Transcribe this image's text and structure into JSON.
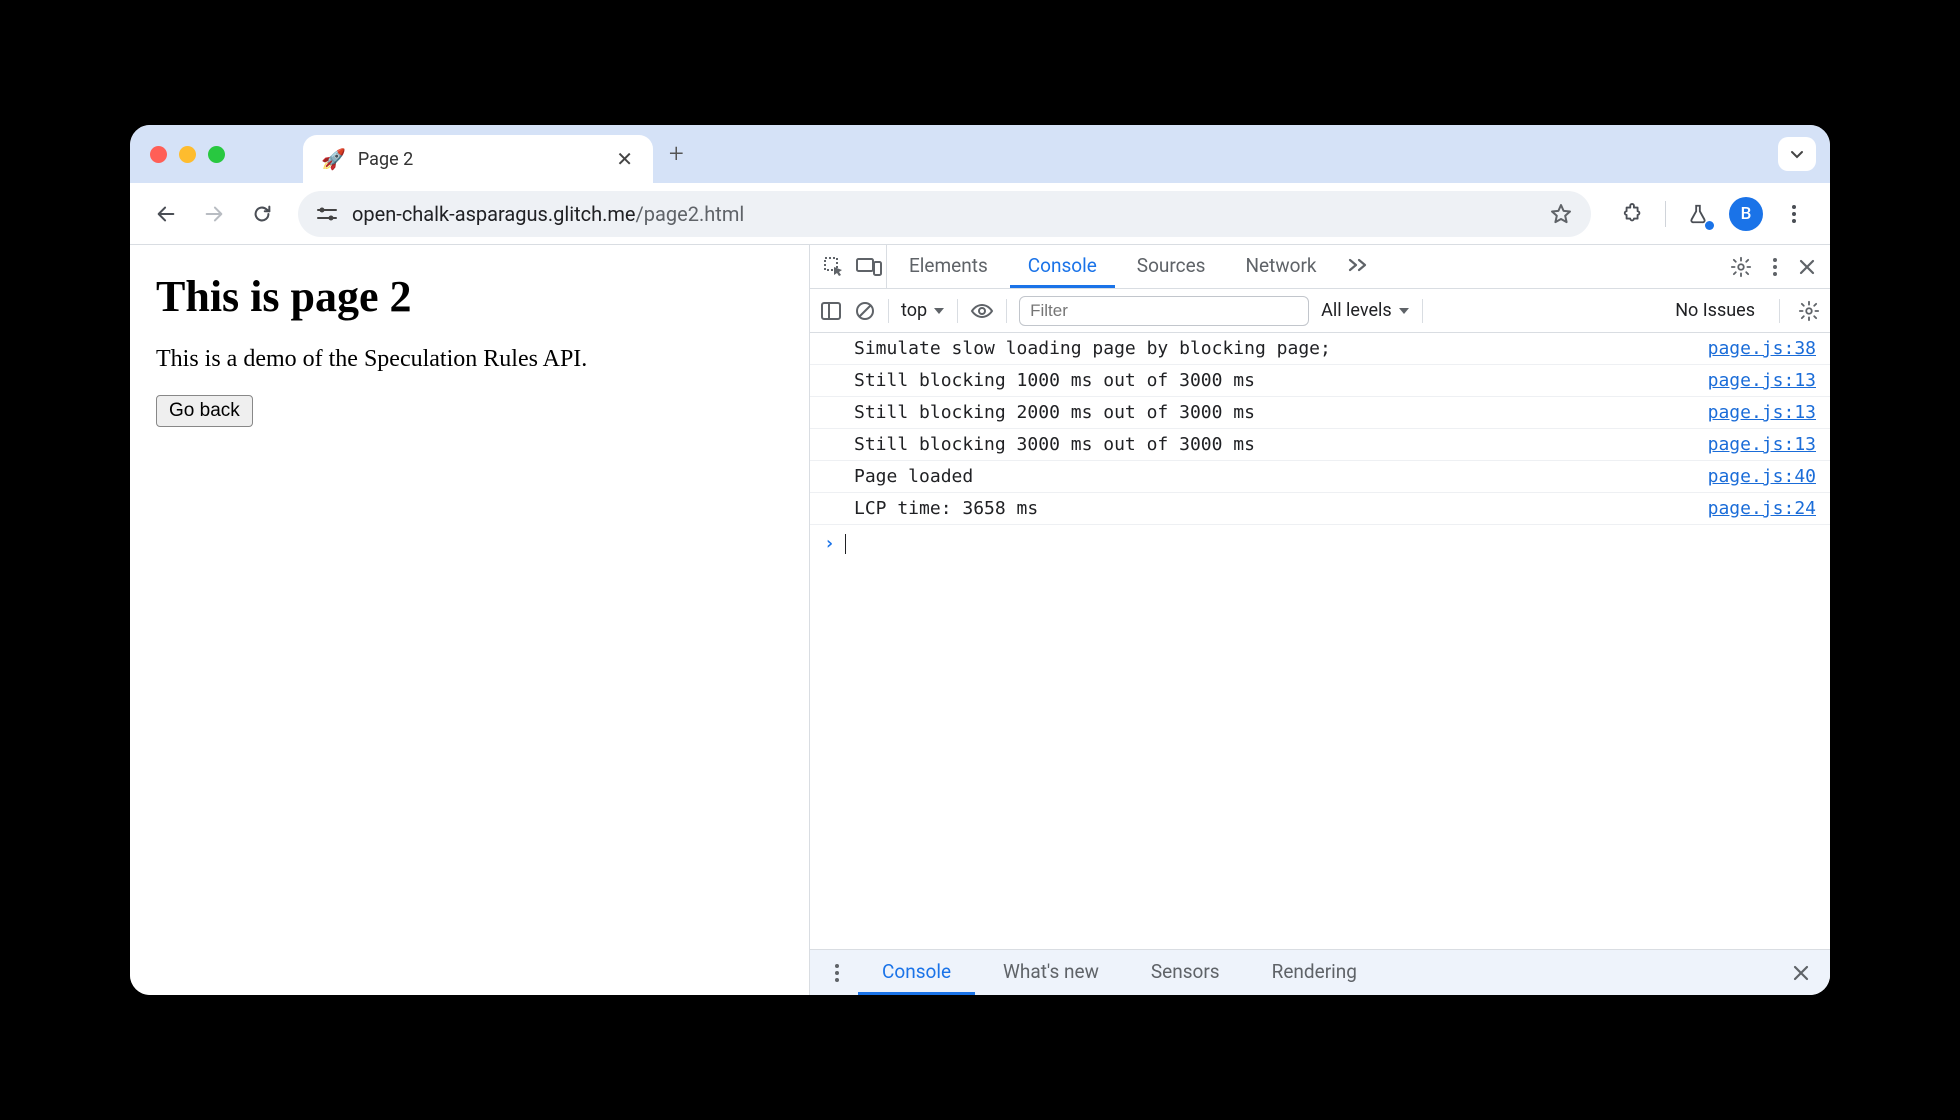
{
  "browser": {
    "tab": {
      "favicon": "🚀",
      "title": "Page 2"
    },
    "url_domain": "open-chalk-asparagus.glitch.me",
    "url_path": "/page2.html",
    "avatar_initial": "B"
  },
  "page": {
    "heading": "This is page 2",
    "description": "This is a demo of the Speculation Rules API.",
    "back_button": "Go back"
  },
  "devtools": {
    "tabs": {
      "elements": "Elements",
      "console": "Console",
      "sources": "Sources",
      "network": "Network"
    },
    "filterbar": {
      "context": "top",
      "filter_placeholder": "Filter",
      "levels": "All levels",
      "no_issues": "No Issues"
    },
    "log": [
      {
        "msg": "Simulate slow loading page by blocking page;",
        "src": "page.js:38"
      },
      {
        "msg": "Still blocking 1000 ms out of 3000 ms",
        "src": "page.js:13"
      },
      {
        "msg": "Still blocking 2000 ms out of 3000 ms",
        "src": "page.js:13"
      },
      {
        "msg": "Still blocking 3000 ms out of 3000 ms",
        "src": "page.js:13"
      },
      {
        "msg": "Page loaded",
        "src": "page.js:40"
      },
      {
        "msg": "LCP time: 3658 ms",
        "src": "page.js:24"
      }
    ],
    "drawer": {
      "console": "Console",
      "whats_new": "What's new",
      "sensors": "Sensors",
      "rendering": "Rendering"
    }
  }
}
